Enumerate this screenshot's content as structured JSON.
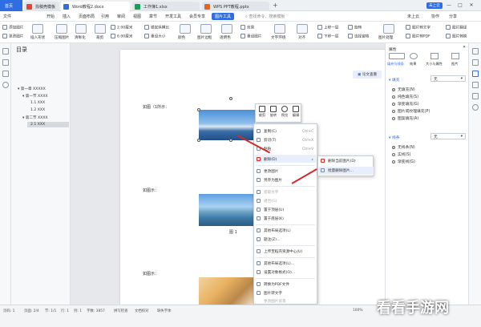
{
  "tabs": {
    "home": "首页",
    "t1": "找稿壳模板",
    "t2": "Word教程2.docx",
    "t3": "工作簿1.xlsx",
    "t4": "WPS PPT教程.pptx",
    "add": "+"
  },
  "window": {
    "user": "未上云",
    "min": "—",
    "max": "□",
    "close": "✕"
  },
  "menu": [
    "文件",
    "开始",
    "插入",
    "页面布局",
    "引用",
    "审阅",
    "视图",
    "章节",
    "开发工具",
    "会员专享",
    "图片工具",
    "查找命令、搜索模板"
  ],
  "menu_right": [
    "未上云",
    "协作",
    "分享"
  ],
  "toolbar": {
    "row1": [
      "添加图片",
      "插入形状",
      "压缩图片",
      "清晰化",
      "裁剪",
      "原始大小",
      "锁定纵横比",
      "颜色",
      "图片边框",
      "透明色",
      "文字环绕",
      "对齐",
      "上移一层",
      "旋转",
      "组合",
      "图片转文字",
      "图片翻译"
    ],
    "row2": [
      "更改图片",
      "",
      "",
      "",
      "",
      "重设大小",
      "重设图片",
      "效果",
      "",
      "",
      "",
      "",
      "下移一层",
      "选择窗格",
      "图片处理",
      "图片转PDF",
      "图片转换"
    ],
    "size_h": "2.00厘米",
    "size_w": "6.00厘米"
  },
  "nav": {
    "title": "目录",
    "items": [
      "第一章 XXXXX",
      "第一节 XXXX",
      "1.1 XXX",
      "1.2 XXX",
      "第二节 XXXX",
      "2.1 XXX"
    ]
  },
  "doc": {
    "fig1": "如图（1所示：",
    "fig2": "如图示：",
    "cap2": "图 1",
    "fig3": "如图示："
  },
  "float_toolbar": [
    "裁剪",
    "旋转",
    "预览",
    "编辑"
  ],
  "context_menu": [
    {
      "label": "复制(C)",
      "key": "Ctrl+C"
    },
    {
      "label": "剪切(T)",
      "key": "Ctrl+X"
    },
    {
      "label": "粘贴",
      "key": "Ctrl+V"
    },
    {
      "label": "删除(D)",
      "key": ""
    },
    {
      "label": "更改图片",
      "key": ""
    },
    {
      "label": "另存为图片",
      "key": ""
    },
    {
      "label": "提取文字",
      "key": ""
    },
    {
      "label": "组合(G)",
      "key": ""
    },
    {
      "label": "置于顶层(U)",
      "key": ""
    },
    {
      "label": "置于底层(K)",
      "key": ""
    },
    {
      "label": "其他布局选项(L)",
      "key": ""
    },
    {
      "label": "题注(Z)...",
      "key": ""
    },
    {
      "label": "上传至稻壳资源中心(U)",
      "key": ""
    },
    {
      "label": "其他布局选项(L)...",
      "key": ""
    },
    {
      "label": "设置对象格式(O)...",
      "key": ""
    },
    {
      "label": "转换为PDF文件",
      "key": ""
    },
    {
      "label": "图片转文字",
      "key": ""
    },
    {
      "label": "更改图片背景",
      "key": ""
    }
  ],
  "submenu": [
    "删除当前图片(D)",
    "批量删除图片..."
  ],
  "right_panel": {
    "tabs": [
      "填充与线条",
      "效果",
      "大小与属性",
      "图片"
    ],
    "header": "属性",
    "fill": {
      "title": "填充",
      "value": "无",
      "options": [
        "无填充(N)",
        "纯色填充(S)",
        "渐变填充(G)",
        "图片或纹理填充(P)",
        "图案填充(A)"
      ]
    },
    "line": {
      "title": "线条",
      "value": "无",
      "options": [
        "无线条(N)",
        "实线(S)",
        "渐变线(G)"
      ]
    },
    "doc_btn": "论文查重"
  },
  "status": [
    "页码: 1",
    "页面: 2/4",
    "节: 1/1",
    "行: 1",
    "列: 1",
    "字数: 3857",
    "拼写检查",
    "文档校对",
    "缺失字体",
    "100%"
  ],
  "watermark": "看看手游网"
}
